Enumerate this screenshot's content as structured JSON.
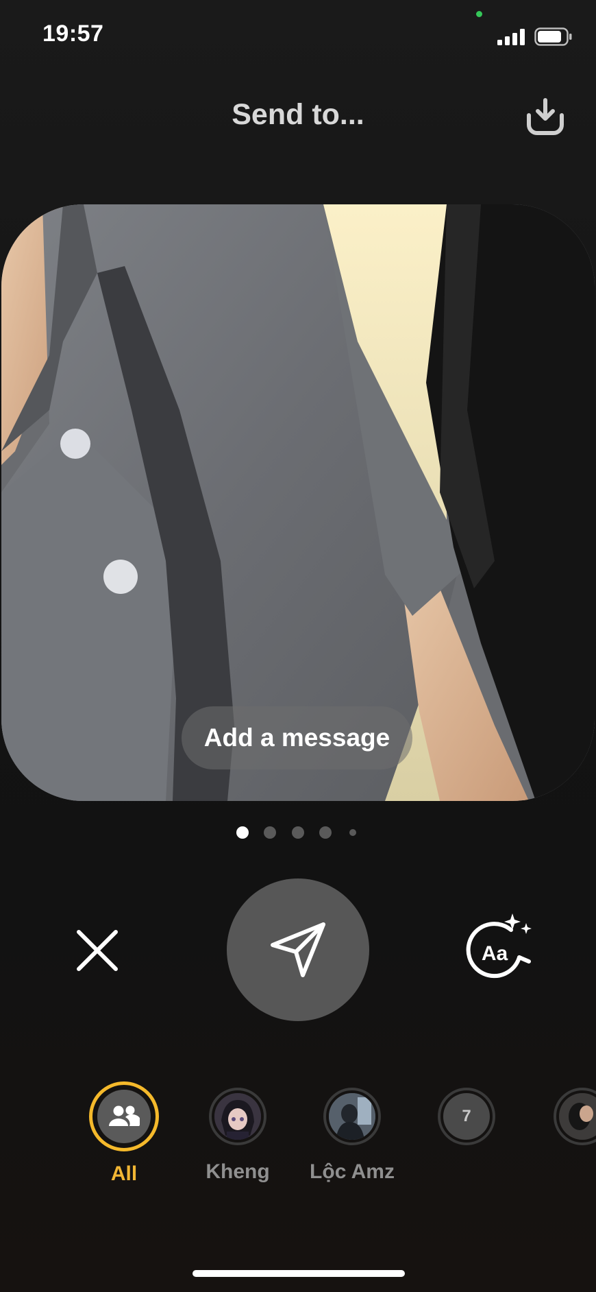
{
  "status_bar": {
    "time": "19:57"
  },
  "header": {
    "title": "Send to...",
    "download_icon": "download-icon"
  },
  "photo": {
    "description_icon": "photo-preview",
    "message_placeholder": "Add a message"
  },
  "pagination": {
    "count": 5,
    "active_index": 0
  },
  "actions": {
    "close_icon": "close-icon",
    "send_icon": "send-icon",
    "text_effect_icon": "text-effect-icon",
    "text_effect_glyph": "Aa"
  },
  "recipients": [
    {
      "label": "All",
      "icon": "group-icon",
      "selected": true
    },
    {
      "label": "Kheng",
      "icon": "avatar-photo",
      "selected": false
    },
    {
      "label": "Lộc Amz",
      "icon": "avatar-photo",
      "selected": false
    },
    {
      "label": "",
      "badge": "7",
      "selected": false
    },
    {
      "label": "",
      "icon": "avatar-photo",
      "selected": false
    }
  ],
  "colors": {
    "accent": "#f5b92b",
    "send_button": "#575757",
    "background": "#121212"
  }
}
